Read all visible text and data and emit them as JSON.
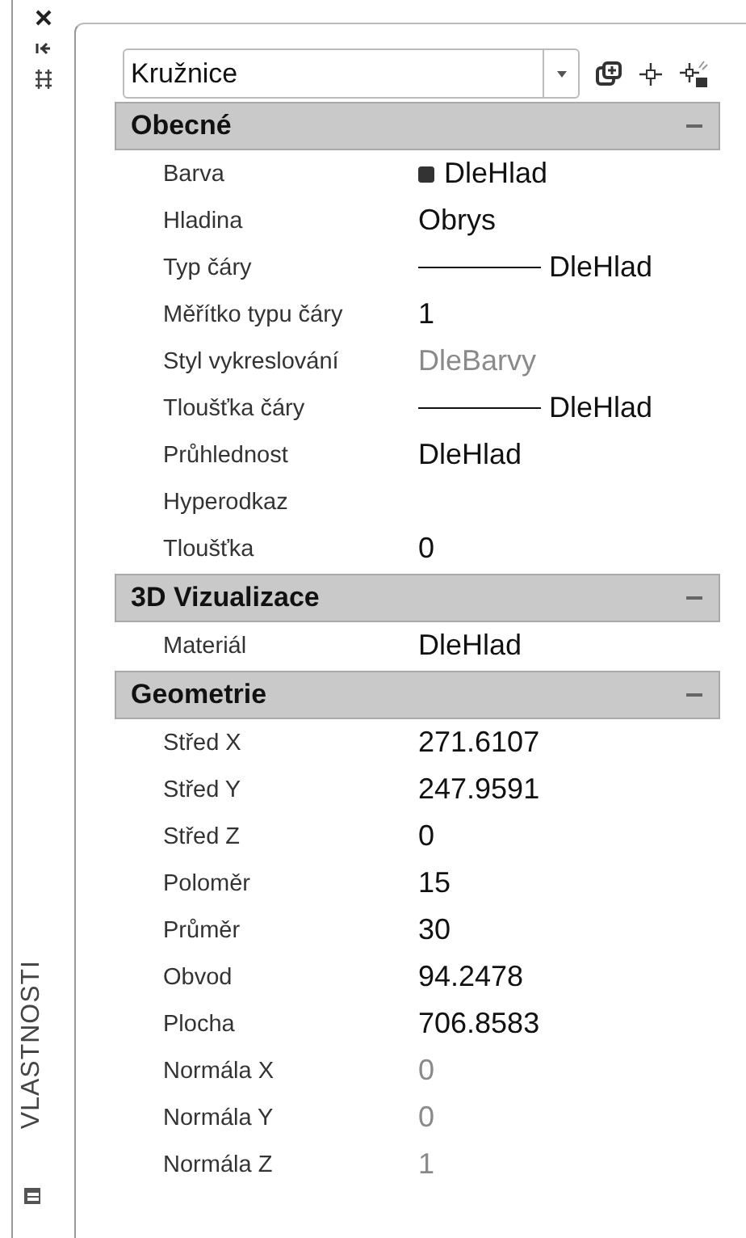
{
  "palette_title": "VLASTNOSTI",
  "object_type": {
    "value": "Kružnice"
  },
  "sections": [
    {
      "title": "Obecné",
      "expanded": true,
      "rows": [
        {
          "label": "Barva",
          "value": "DleHlad",
          "kind": "color",
          "disabled": false
        },
        {
          "label": "Hladina",
          "value": "Obrys",
          "kind": "text",
          "disabled": false
        },
        {
          "label": "Typ čáry",
          "value": "DleHlad",
          "kind": "line",
          "disabled": false
        },
        {
          "label": "Měřítko typu čáry",
          "value": "1",
          "kind": "text",
          "disabled": false
        },
        {
          "label": "Styl vykreslování",
          "value": "DleBarvy",
          "kind": "text",
          "disabled": true
        },
        {
          "label": "Tloušťka čáry",
          "value": "DleHlad",
          "kind": "line",
          "disabled": false
        },
        {
          "label": "Průhlednost",
          "value": "DleHlad",
          "kind": "text",
          "disabled": false
        },
        {
          "label": "Hyperodkaz"
        },
        {
          "label": "Tloušťka",
          "value": "0",
          "kind": "text",
          "disabled": false
        }
      ]
    },
    {
      "title": "3D Vizualizace",
      "expanded": true,
      "rows": [
        {
          "label": "Materiál",
          "value": "DleHlad",
          "kind": "text",
          "disabled": false
        }
      ]
    },
    {
      "title": "Geometrie",
      "expanded": true,
      "rows": [
        {
          "label": "Střed X",
          "value": "271.6107",
          "kind": "text",
          "disabled": false
        },
        {
          "label": "Střed Y",
          "value": "247.9591",
          "kind": "text",
          "disabled": false
        },
        {
          "label": "Střed Z",
          "value": "0",
          "kind": "text",
          "disabled": false
        },
        {
          "label": "Poloměr",
          "value": "15",
          "kind": "text",
          "disabled": false
        },
        {
          "label": "Průměr",
          "value": "30",
          "kind": "text",
          "disabled": false
        },
        {
          "label": "Obvod",
          "value": "94.2478",
          "kind": "text",
          "disabled": false
        },
        {
          "label": "Plocha",
          "value": "706.8583",
          "kind": "text",
          "disabled": false
        },
        {
          "label": "Normála X",
          "value": "0",
          "kind": "text",
          "disabled": true
        },
        {
          "label": "Normála Y",
          "value": "0",
          "kind": "text",
          "disabled": true
        },
        {
          "label": "Normála Z",
          "value": "1",
          "kind": "text",
          "disabled": true
        }
      ]
    }
  ]
}
